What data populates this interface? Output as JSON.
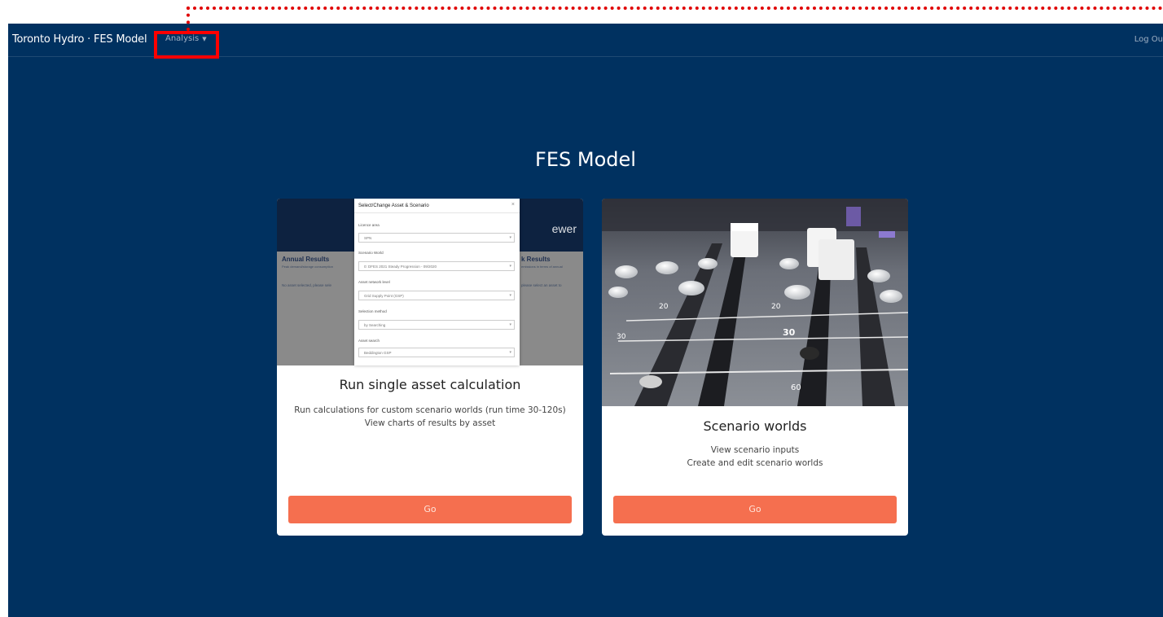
{
  "navbar": {
    "brand": "Toronto Hydro · FES Model",
    "analysis_label": "Analysis",
    "logout_label": "Log Ou"
  },
  "page_title": "FES Model",
  "cards": [
    {
      "title": "Run single asset calculation",
      "desc_line1": "Run calculations for custom scenario worlds (run time 30-120s)",
      "desc_line2": "View charts of results by asset",
      "button": "Go",
      "screenshot": {
        "header_text": "ewer",
        "left_title": "Annual Results",
        "left_sub": "Peak demand/storage consumption",
        "left_note": "No asset selected, please sele",
        "right_title": "k Results",
        "right_sub": "emissions in terms of annual",
        "right_note": "please select an asset to",
        "modal_title": "Select/Change Asset & Scenario",
        "close": "×",
        "fields": [
          {
            "label": "Licence area",
            "value": "SPN"
          },
          {
            "label": "Scenario World",
            "value": "0: DFES 2021 Steady Progression - 09/2020"
          },
          {
            "label": "Asset network level",
            "value": "Grid Supply Point (GSP)"
          },
          {
            "label": "Selection method",
            "value": "by Searching"
          },
          {
            "label": "Asset search",
            "value": "Beddington GSP"
          }
        ]
      }
    },
    {
      "title": "Scenario worlds",
      "desc_line1": "View scenario inputs",
      "desc_line2": "Create and edit scenario worlds",
      "button": "Go",
      "mixer_labels": [
        "20",
        "20",
        "30",
        "30",
        "60"
      ]
    }
  ],
  "colors": {
    "background": "#003160",
    "button": "#f56f4f",
    "highlight": "#ff0000"
  }
}
